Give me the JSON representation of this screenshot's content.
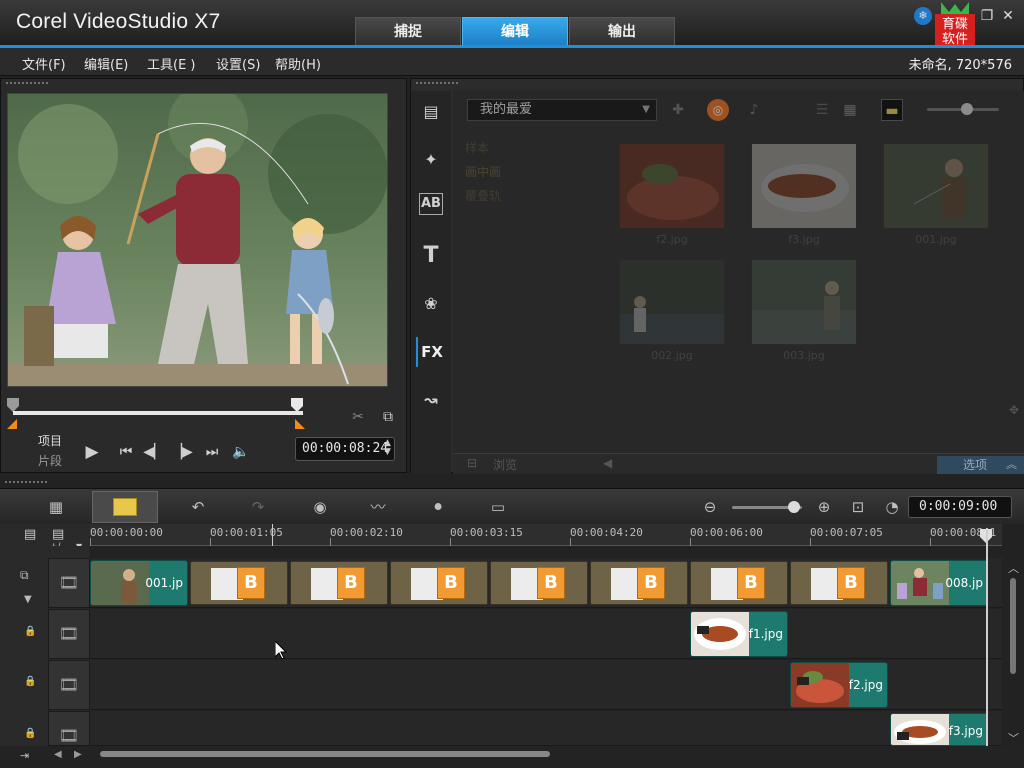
{
  "app": {
    "title": "Corel VideoStudio X7"
  },
  "mode_tabs": [
    {
      "label": "捕捉",
      "active": false
    },
    {
      "label": "编辑",
      "active": true
    },
    {
      "label": "输出",
      "active": false
    }
  ],
  "logo": {
    "text": "育碟软件"
  },
  "menu": [
    {
      "label": "文件(F)"
    },
    {
      "label": "编辑(E)"
    },
    {
      "label": "工具(E )"
    },
    {
      "label": "设置(S)"
    },
    {
      "label": "帮助(H)"
    }
  ],
  "project_info": "未命名, 720*576",
  "preview": {
    "mode_project": "项目",
    "mode_clip": "片段",
    "timecode": "00:00:08:24"
  },
  "library": {
    "gallery": "我的最爱",
    "categories": [
      "样本",
      "画中画",
      "覆叠轨"
    ],
    "thumbnails": [
      {
        "label": "f2.jpg"
      },
      {
        "label": "f3.jpg"
      },
      {
        "label": "001.jpg"
      },
      {
        "label": "002.jpg"
      },
      {
        "label": "003.jpg"
      }
    ],
    "browse": "浏览",
    "options": "选项"
  },
  "timeline": {
    "total_time": "0:00:09:00",
    "ruler_ticks": [
      "00:00:00:00",
      "00:00:01:05",
      "00:00:02:10",
      "00:00:03:15",
      "00:00:04:20",
      "00:00:06:00",
      "00:00:07:05",
      "00:00:08:1"
    ],
    "add_remove": "+/-",
    "tracks": [
      {
        "clips": [
          {
            "label": "001.jp"
          },
          {
            "label": "008.jp"
          }
        ]
      },
      {
        "clips": [
          {
            "label": "f1.jpg"
          }
        ]
      },
      {
        "clips": [
          {
            "label": "f2.jpg"
          }
        ]
      },
      {
        "clips": [
          {
            "label": "f3.jpg"
          }
        ]
      }
    ]
  },
  "colors": {
    "accent": "#1e8fd8",
    "clip_teal": "#1e7a6e",
    "transition_brown": "#6e6347",
    "transition_b": "#f29b33"
  }
}
